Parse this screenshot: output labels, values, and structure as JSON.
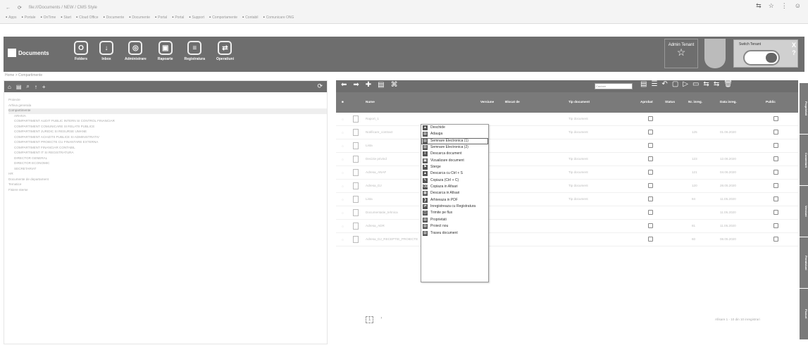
{
  "browser": {
    "address": "file:///Documents / NEW / CMS Style",
    "bookmarks": [
      "Apps",
      "Portale",
      "OnTime",
      "Start",
      "Cloud Office",
      "Documente",
      "Documente",
      "Portal",
      "Portal",
      "Support",
      "Comportamente",
      "Contabil",
      "Comunicare ONG"
    ]
  },
  "header": {
    "brand": "Documents",
    "modules": [
      {
        "icon": "O",
        "label": "Folders"
      },
      {
        "icon": "↓",
        "label": "Inbox"
      },
      {
        "icon": "◎",
        "label": "Administrare"
      },
      {
        "icon": "▣",
        "label": "Rapoarte"
      },
      {
        "icon": "≡",
        "label": "Registratura"
      },
      {
        "icon": "⇄",
        "label": "Operatiuni"
      }
    ],
    "badge1": "Admin Tenant",
    "user_label": "Switch Tenant",
    "close_glyph": "X",
    "help_glyph": "?"
  },
  "breadcrumb": "Home > Compartimente",
  "tree": [
    {
      "label": "Proiecte",
      "level": 0,
      "selected": false
    },
    {
      "label": "Arhiva generala",
      "level": 0,
      "selected": false
    },
    {
      "label": "Compartimente",
      "level": 0,
      "selected": true
    },
    {
      "label": "ARHIVA",
      "level": 1,
      "selected": false
    },
    {
      "label": "COMPARTIMENT AUDIT PUBLIC INTERN SI CONTROL FINANCIAR",
      "level": 1,
      "selected": false
    },
    {
      "label": "COMPARTIMENT COMUNICARE SI RELATII PUBLICE",
      "level": 1,
      "selected": false
    },
    {
      "label": "COMPARTIMENT JURIDIC SI RESURSE UMANE",
      "level": 1,
      "selected": false
    },
    {
      "label": "COMPARTIMENT ACHIZITII PUBLICE SI ADMINISTRATIV",
      "level": 1,
      "selected": false
    },
    {
      "label": "COMPARTIMENT PROIECTE CU FINANTARE EXTERNA",
      "level": 1,
      "selected": false
    },
    {
      "label": "COMPARTIMENT FINANCIAR CONTABIL",
      "level": 1,
      "selected": false
    },
    {
      "label": "COMPARTIMENT IT SI REGISTRATURA",
      "level": 1,
      "selected": false
    },
    {
      "label": "DIRECTOR GENERAL",
      "level": 1,
      "selected": false
    },
    {
      "label": "DIRECTOR ECONOMIC",
      "level": 1,
      "selected": false
    },
    {
      "label": "SECRETARIAT",
      "level": 1,
      "selected": false
    },
    {
      "label": "HR",
      "level": 0,
      "selected": false
    },
    {
      "label": "Documente de departament",
      "level": 0,
      "selected": false
    },
    {
      "label": "Tematice",
      "level": 0,
      "selected": false
    },
    {
      "label": "Fisiere sterse",
      "level": 0,
      "selected": false
    }
  ],
  "right_toolbar": {
    "nav": [
      "⬅",
      "➡",
      "✚",
      "▤",
      "⌘"
    ],
    "search_placeholder": "Cautare",
    "tools": [
      "▤",
      "☰",
      "↶",
      "▢",
      "▷",
      "▭",
      "⇆",
      "⇆",
      "🗑"
    ]
  },
  "grid": {
    "headers": [
      "Nume",
      "Versiune",
      "Blocat de",
      "Tip document",
      "Aprobat",
      "Status",
      "Nr. inreg.",
      "Data inreg.",
      "Public"
    ],
    "rows": [
      {
        "name": "Raport_1",
        "type": "Tip document",
        "nr": "",
        "date": ""
      },
      {
        "name": "Notificare_contract",
        "type": "Tip document",
        "nr": "125",
        "date": "01.06.2020"
      },
      {
        "name": "Lista",
        "type": "",
        "nr": "",
        "date": ""
      },
      {
        "name": "Decizie privind",
        "type": "Tip document",
        "nr": "123",
        "date": "12.06.2020"
      },
      {
        "name": "Adresa_ANAF",
        "type": "Tip document",
        "nr": "121",
        "date": "04.06.2020"
      },
      {
        "name": "Adresa_DJ",
        "type": "Tip document",
        "nr": "120",
        "date": "28.05.2020"
      },
      {
        "name": "Lista",
        "type": "Tip document",
        "nr": "84",
        "date": "11.05.2020"
      },
      {
        "name": "Documentatie_tehnica",
        "type": "",
        "nr": "",
        "date": "11.05.2020"
      },
      {
        "name": "Adresa_ADR",
        "type": "",
        "nr": "81",
        "date": "11.05.2020"
      },
      {
        "name": "Adresa_DJ_RECEPTIE_PROIECTE",
        "type": "",
        "nr": "60",
        "date": "06.05.2020"
      }
    ],
    "pager": "1",
    "count": "Afisare 1 - 10 din 10 inregistrari"
  },
  "side_tabs": [
    "Proprietati",
    "Comentarii",
    "Versiuni",
    "Permisiuni",
    "Fluxuri"
  ],
  "context_menu": [
    {
      "icon": "▲",
      "label": "Deschide"
    },
    {
      "icon": "▤",
      "label": "Adauga"
    },
    {
      "icon": "▤",
      "label": "Semnare Electronica (1)",
      "highlight": true
    },
    {
      "icon": "▤",
      "label": "Semnare Electronica (2)"
    },
    {
      "icon": "⇩",
      "label": "Descarca document"
    },
    {
      "icon": "▣",
      "label": "Vizualizare document"
    },
    {
      "icon": "⚑",
      "label": "Sterge"
    },
    {
      "icon": "▲",
      "label": "Descarca cu Ctrl + S"
    },
    {
      "icon": "✎",
      "label": "Copiaza (Ctrl + C)"
    },
    {
      "icon": "⌫",
      "label": "Copiaza in Afisari"
    },
    {
      "icon": "▦",
      "label": "Descarca in Afisari"
    },
    {
      "icon": "❯",
      "label": "Arhiveaza in PDF"
    },
    {
      "icon": "⇄",
      "label": "Inregistreaza cu Registratura"
    },
    {
      "icon": "◫",
      "label": "Trimite pe flux"
    },
    {
      "icon": "▤",
      "label": "Proprietati"
    },
    {
      "icon": "▤",
      "label": "Proiect nou"
    },
    {
      "icon": "▤",
      "label": "Traseu document"
    }
  ]
}
